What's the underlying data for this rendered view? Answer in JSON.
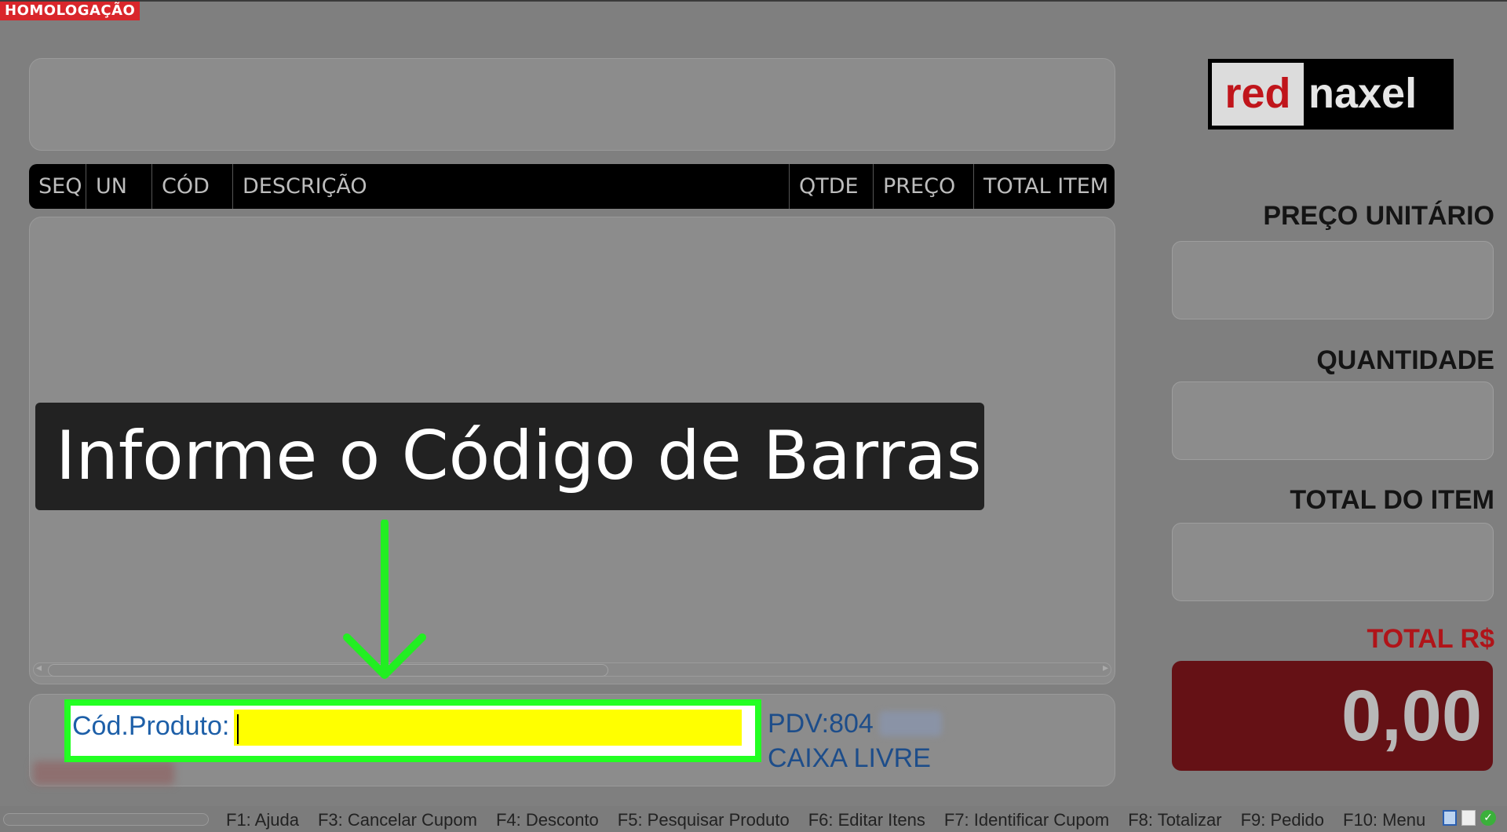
{
  "env_badge": "HOMOLOGAÇÃO",
  "table": {
    "columns": [
      "SEQ",
      "UN",
      "CÓD",
      "DESCRIÇÃO",
      "QTDE",
      "PREÇO",
      "TOTAL ITEM"
    ],
    "rows": []
  },
  "callout": {
    "text": "Informe o Código de Barras"
  },
  "product_entry": {
    "label": "Cód.Produto:",
    "value": ""
  },
  "pdv": {
    "label": "PDV:804",
    "status": "CAIXA LIVRE"
  },
  "logo": {
    "red_part": "red",
    "white_part": "naxel"
  },
  "side": {
    "unit_price_label": "PREÇO UNITÁRIO",
    "quantity_label": "QUANTIDADE",
    "item_total_label": "TOTAL DO ITEM",
    "total_label": "TOTAL R$",
    "total_value": "0,00"
  },
  "function_keys": [
    "F1: Ajuda",
    "F3: Cancelar Cupom",
    "F4: Desconto",
    "F5: Pesquisar Produto",
    "F6: Editar Itens",
    "F7: Identificar Cupom",
    "F8: Totalizar",
    "F9: Pedido",
    "F10: Menu"
  ],
  "colors": {
    "highlight_border": "#22ff22",
    "input_bg": "#ffff00",
    "total_box": "#651115",
    "brand_red": "#c0151b"
  },
  "icons": [
    "window-icon",
    "document-icon",
    "status-ok-icon",
    "arrow-down-icon"
  ]
}
